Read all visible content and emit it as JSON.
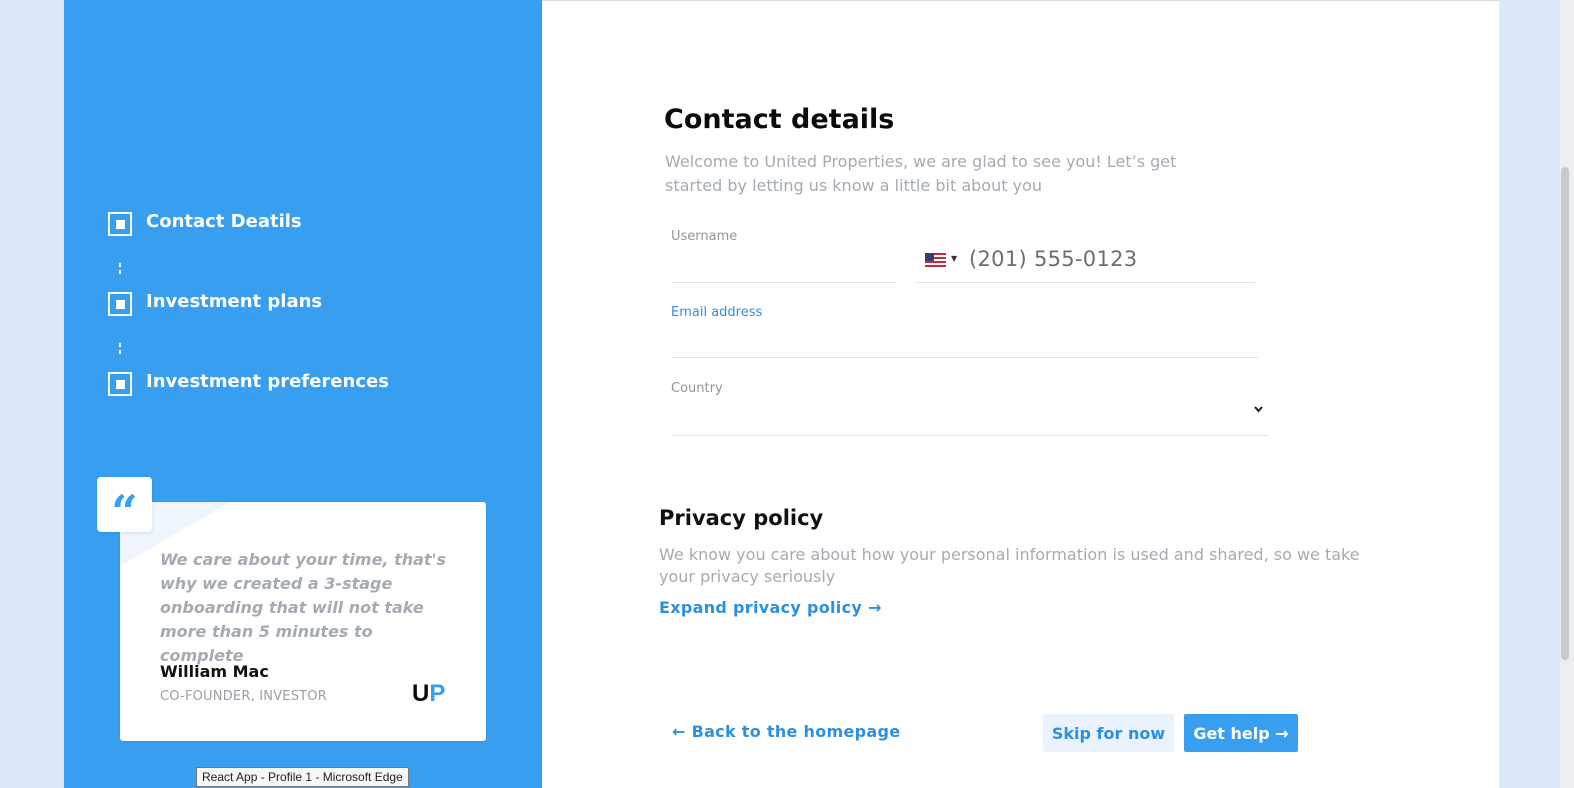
{
  "sidebar": {
    "steps": [
      {
        "label": "Contact Deatils"
      },
      {
        "label": "Investment plans"
      },
      {
        "label": "Investment preferences"
      }
    ],
    "quote": {
      "text": "We care about your time, that's why we created a 3-stage onboarding that will not take more than 5 minutes to complete",
      "author": "William Mac",
      "role": "CO-FOUNDER, INVESTOR",
      "logo_u": "U",
      "logo_p": "P"
    }
  },
  "tooltip": "React App - Profile 1 - Microsoft Edge",
  "form": {
    "title": "Contact details",
    "subtitle": "Welcome to United Properties, we are glad to see you! Let’s get started by letting us know a little bit about you",
    "username_label": "Username",
    "phone_value": "(201) 555-0123",
    "flag_icon": "us-flag-icon",
    "email_label": "Email address",
    "country_label": "Country"
  },
  "privacy": {
    "heading": "Privacy policy",
    "text": "We know you care about how your personal information is used and shared, so we take your privacy seriously",
    "link": "Expand privacy policy →"
  },
  "footer": {
    "back": "← Back to the homepage",
    "skip": "Skip for now",
    "help": "Get help →"
  },
  "colors": {
    "accent": "#389ff0",
    "link": "#2d8fe0",
    "muted": "#a4abb3"
  }
}
